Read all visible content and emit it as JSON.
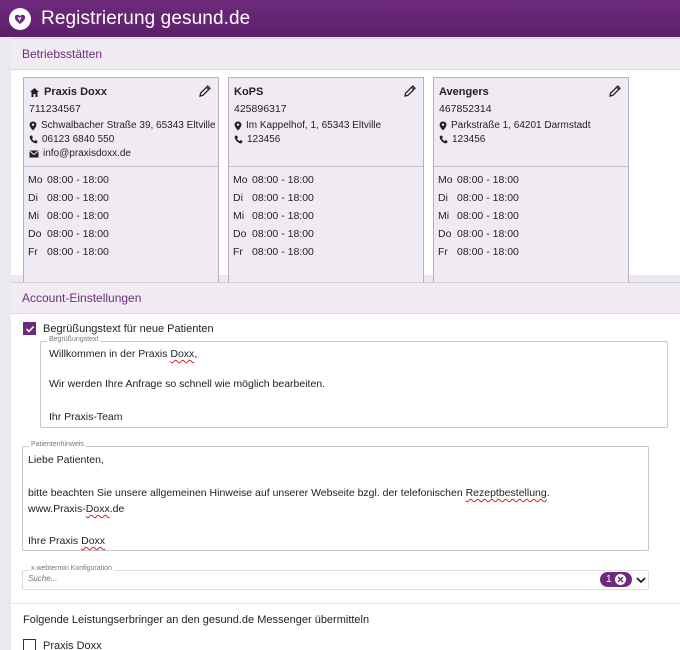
{
  "app": {
    "title": "Registrierung gesund.de"
  },
  "betriebsstaetten": {
    "heading": "Betriebsstätten",
    "sites": [
      {
        "name": "Praxis Doxx",
        "is_home": true,
        "id": "711234567",
        "address": "Schwalbacher Straße 39, 65343 Eltville",
        "phone": "06123 6840 550",
        "email": "info@praxisdoxx.de",
        "hours": [
          {
            "day": "Mo",
            "time": "08:00 - 18:00"
          },
          {
            "day": "Di",
            "time": "08:00 - 18:00"
          },
          {
            "day": "Mi",
            "time": "08:00 - 18:00"
          },
          {
            "day": "Do",
            "time": "08:00 - 18:00"
          },
          {
            "day": "Fr",
            "time": "08:00 - 18:00"
          }
        ]
      },
      {
        "name": "KoPS",
        "is_home": false,
        "id": "425896317",
        "address": "Im Kappelhof, 1, 65343 Eltville",
        "phone": "123456",
        "email": "",
        "hours": [
          {
            "day": "Mo",
            "time": "08:00 - 18:00"
          },
          {
            "day": "Di",
            "time": "08:00 - 18:00"
          },
          {
            "day": "Mi",
            "time": "08:00 - 18:00"
          },
          {
            "day": "Do",
            "time": "08:00 - 18:00"
          },
          {
            "day": "Fr",
            "time": "08:00 - 18:00"
          }
        ]
      },
      {
        "name": "Avengers",
        "is_home": false,
        "id": "467852314",
        "address": "Parkstraße 1, 64201 Darmstadt",
        "phone": "123456",
        "email": "",
        "hours": [
          {
            "day": "Mo",
            "time": "08:00 - 18:00"
          },
          {
            "day": "Di",
            "time": "08:00 - 18:00"
          },
          {
            "day": "Mi",
            "time": "08:00 - 18:00"
          },
          {
            "day": "Do",
            "time": "08:00 - 18:00"
          },
          {
            "day": "Fr",
            "time": "08:00 - 18:00"
          }
        ]
      }
    ]
  },
  "account": {
    "heading": "Account-Einstellungen",
    "welcome_checkbox": {
      "label": "Begrüßungstext für neue Patienten",
      "checked": true
    },
    "welcome_text": {
      "legend": "Begrüßungstext",
      "line1": "Willkommen in der Praxis ",
      "line1_word": "Doxx",
      "line1_end": ",",
      "line2": "Wir werden Ihre Anfrage so schnell wie möglich bearbeiten.",
      "line3": "Ihr Praxis-Team"
    },
    "patient_notice": {
      "legend": "Patientenhinweis",
      "line1": "Liebe Patienten,",
      "line2": "bitte beachten Sie unsere allgemeinen Hinweise auf unserer Webseite bzgl. der telefonischen ",
      "line2_word": "Rezeptbestellung",
      "line2_end": ".",
      "line3_a": "www.Praxis-",
      "line3_word": "Doxx",
      "line3_b": ".de",
      "line4": "Ihre Praxis ",
      "line4_word": "Doxx"
    },
    "webtermin": {
      "legend": "x.webtermin Konfiguration",
      "placeholder": "Suche...",
      "count": "1"
    },
    "messenger": {
      "heading": "Folgende Leistungserbringer an den gesund.de Messenger übermitteln",
      "items": [
        {
          "label": "Praxis Doxx",
          "checked": false
        }
      ]
    }
  },
  "colors": {
    "brand": "#6e2b7c",
    "panel_head_bg": "#f1ecf2",
    "card_bg": "#f0ebf2"
  }
}
